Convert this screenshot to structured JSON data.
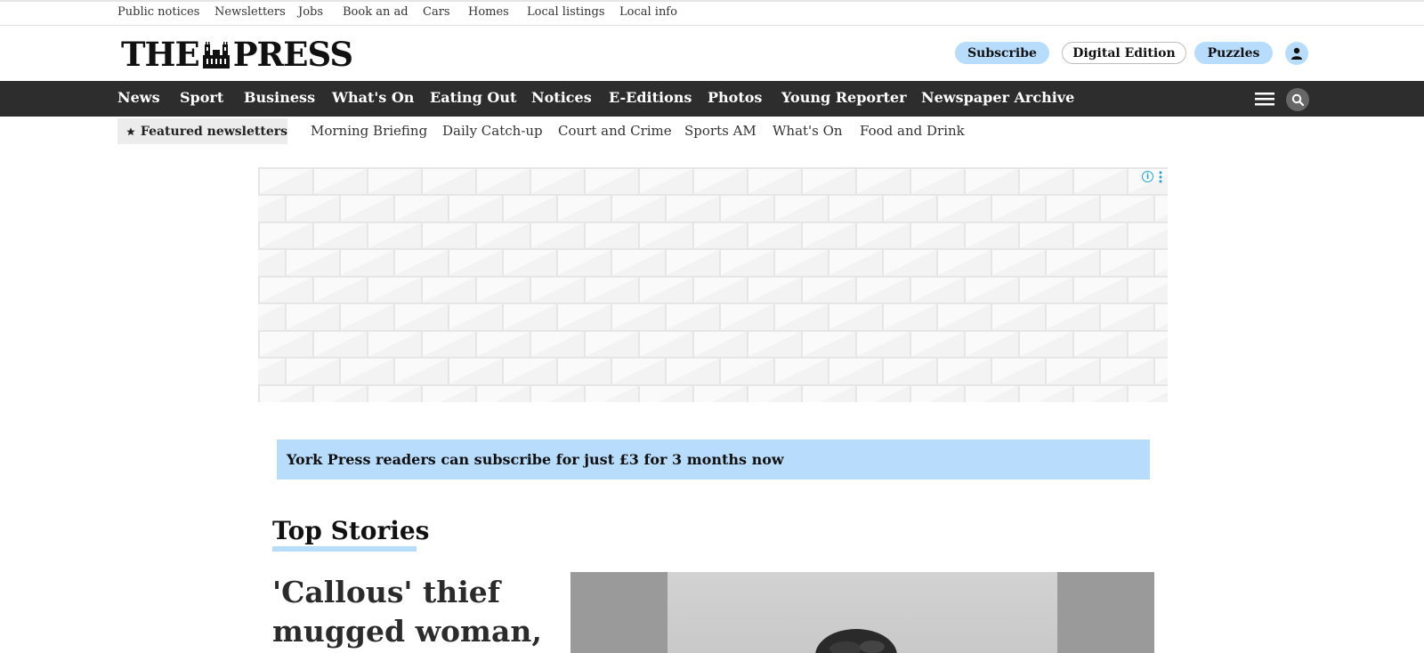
{
  "utility_nav": [
    "Public notices",
    "Newsletters",
    "Jobs",
    "Book an ad",
    "Cars",
    "Homes",
    "Local listings",
    "Local info"
  ],
  "masthead": {
    "logo_left": "THE",
    "logo_right": "PRESS",
    "subscribe_label": "Subscribe",
    "digital_label": "Digital Edition",
    "puzzles_label": "Puzzles",
    "accent_color": "#b8dcfb"
  },
  "main_nav": [
    "News",
    "Sport",
    "Business",
    "What's On",
    "Eating Out",
    "Notices",
    "E-Editions",
    "Photos",
    "Young Reporter",
    "Newspaper Archive"
  ],
  "newsletters": {
    "featured_label": "Featured newsletters",
    "items": [
      "Morning Briefing",
      "Daily Catch-up",
      "Court and Crime",
      "Sports AM",
      "What's On",
      "Food and Drink"
    ]
  },
  "ad": {
    "info_icon": "i"
  },
  "promo": {
    "text": "York Press readers can subscribe for just £3 for 3 months now"
  },
  "top_stories": {
    "title": "Top Stories",
    "lead_headline": "'Callous' thief mugged woman,"
  },
  "icons": {
    "star": "star-icon",
    "user": "user-icon",
    "menu": "hamburger-icon",
    "search": "search-icon"
  }
}
